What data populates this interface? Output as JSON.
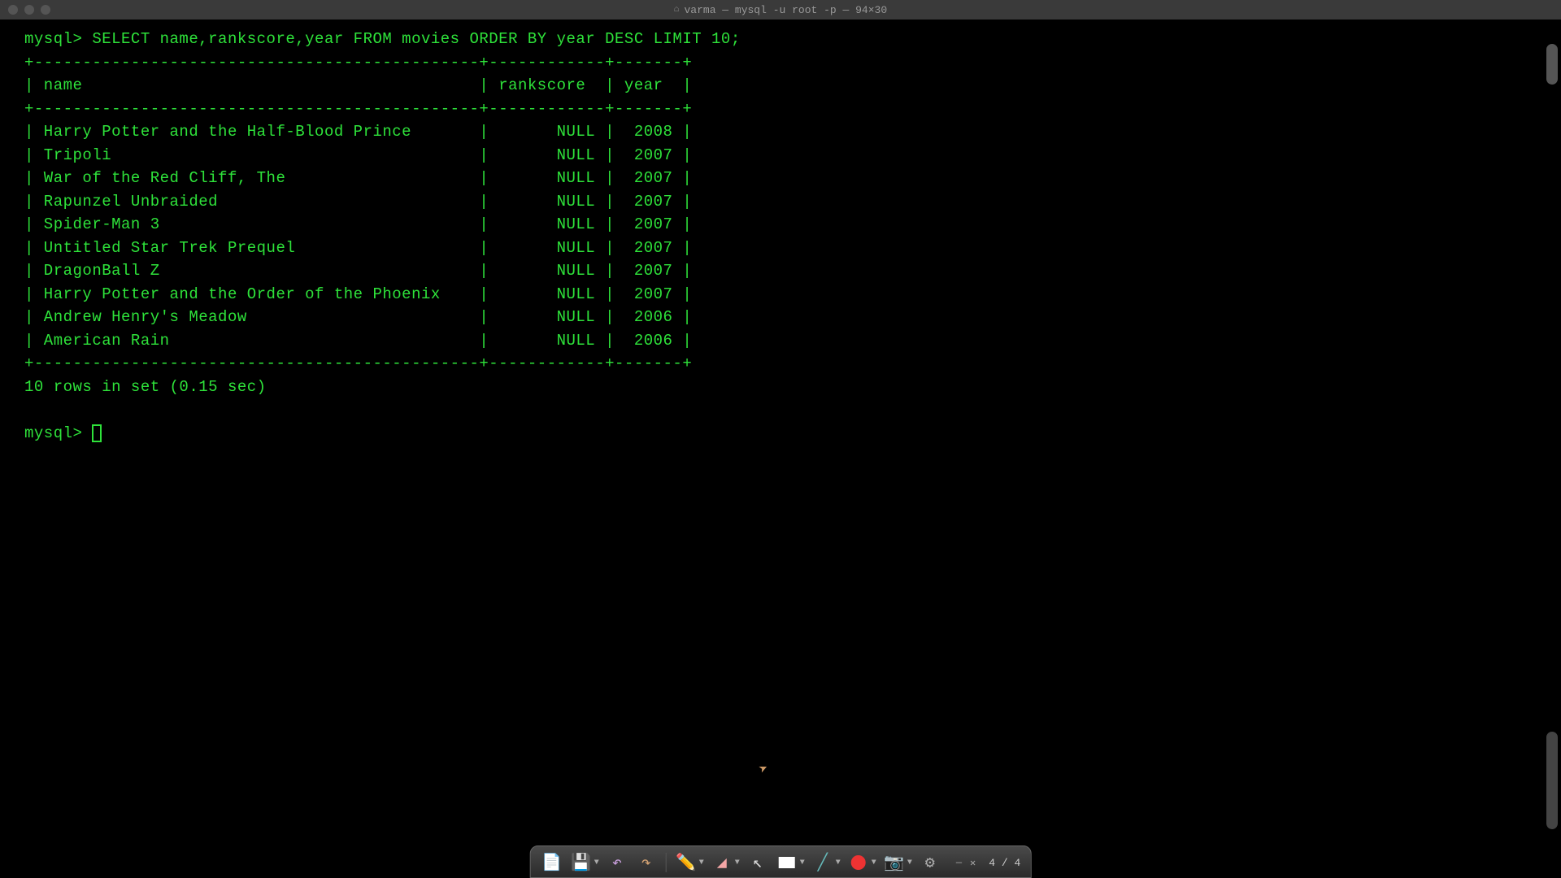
{
  "titlebar": {
    "title": "varma — mysql -u root -p — 94×30"
  },
  "terminal": {
    "prompt": "mysql>",
    "query": "SELECT name,rankscore,year FROM movies ORDER BY year DESC LIMIT 10;",
    "columns": [
      "name",
      "rankscore",
      "year"
    ],
    "rows": [
      {
        "name": "Harry Potter and the Half-Blood Prince",
        "rankscore": "NULL",
        "year": "2008"
      },
      {
        "name": "Tripoli",
        "rankscore": "NULL",
        "year": "2007"
      },
      {
        "name": "War of the Red Cliff, The",
        "rankscore": "NULL",
        "year": "2007"
      },
      {
        "name": "Rapunzel Unbraided",
        "rankscore": "NULL",
        "year": "2007"
      },
      {
        "name": "Spider-Man 3",
        "rankscore": "NULL",
        "year": "2007"
      },
      {
        "name": "Untitled Star Trek Prequel",
        "rankscore": "NULL",
        "year": "2007"
      },
      {
        "name": "DragonBall Z",
        "rankscore": "NULL",
        "year": "2007"
      },
      {
        "name": "Harry Potter and the Order of the Phoenix",
        "rankscore": "NULL",
        "year": "2007"
      },
      {
        "name": "Andrew Henry's Meadow",
        "rankscore": "NULL",
        "year": "2006"
      },
      {
        "name": "American Rain",
        "rankscore": "NULL",
        "year": "2006"
      }
    ],
    "status": "10 rows in set (0.15 sec)"
  },
  "toolbar": {
    "counter": "4 / 4"
  }
}
